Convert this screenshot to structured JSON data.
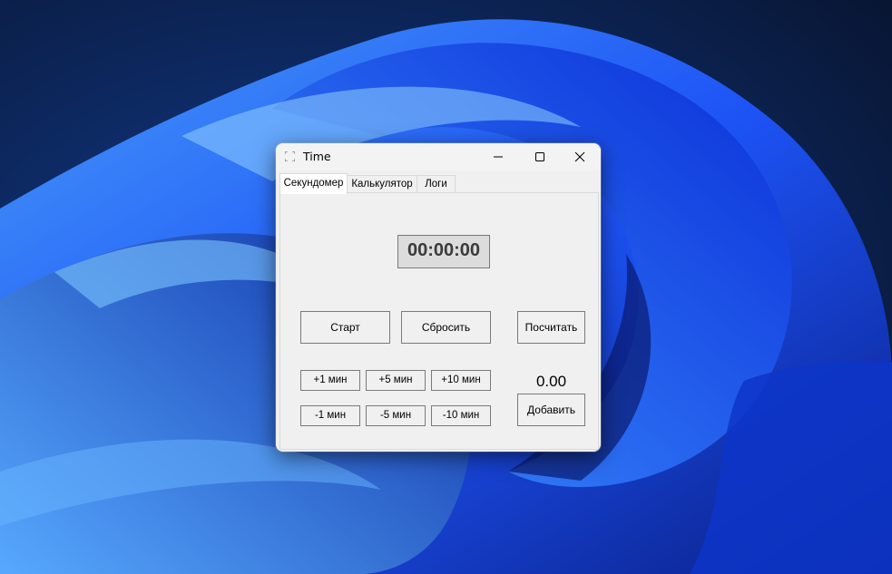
{
  "window": {
    "title": "Time",
    "icon": "app-icon",
    "controls": [
      "minimize-icon",
      "maximize-icon",
      "close-icon"
    ]
  },
  "tabs": [
    {
      "label": "Секундомер",
      "active": true
    },
    {
      "label": "Калькулятор",
      "active": false
    },
    {
      "label": "Логи",
      "active": false
    }
  ],
  "stopwatch": {
    "display": "00:00:00",
    "start_label": "Старт",
    "reset_label": "Сбросить",
    "calc_label": "Посчитать",
    "add_label": "Добавить",
    "result": "0.00",
    "plus_buttons": [
      "+1 мин",
      "+5 мин",
      "+10 мин"
    ],
    "minus_buttons": [
      "-1 мин",
      "-5 мин",
      "-10 мин"
    ]
  },
  "colors": {
    "window_bg": "#f0f0f0",
    "display_bg": "#dcdcdc",
    "button_border": "#7a7a7a",
    "wallpaper_accent": "#1f5bff"
  }
}
